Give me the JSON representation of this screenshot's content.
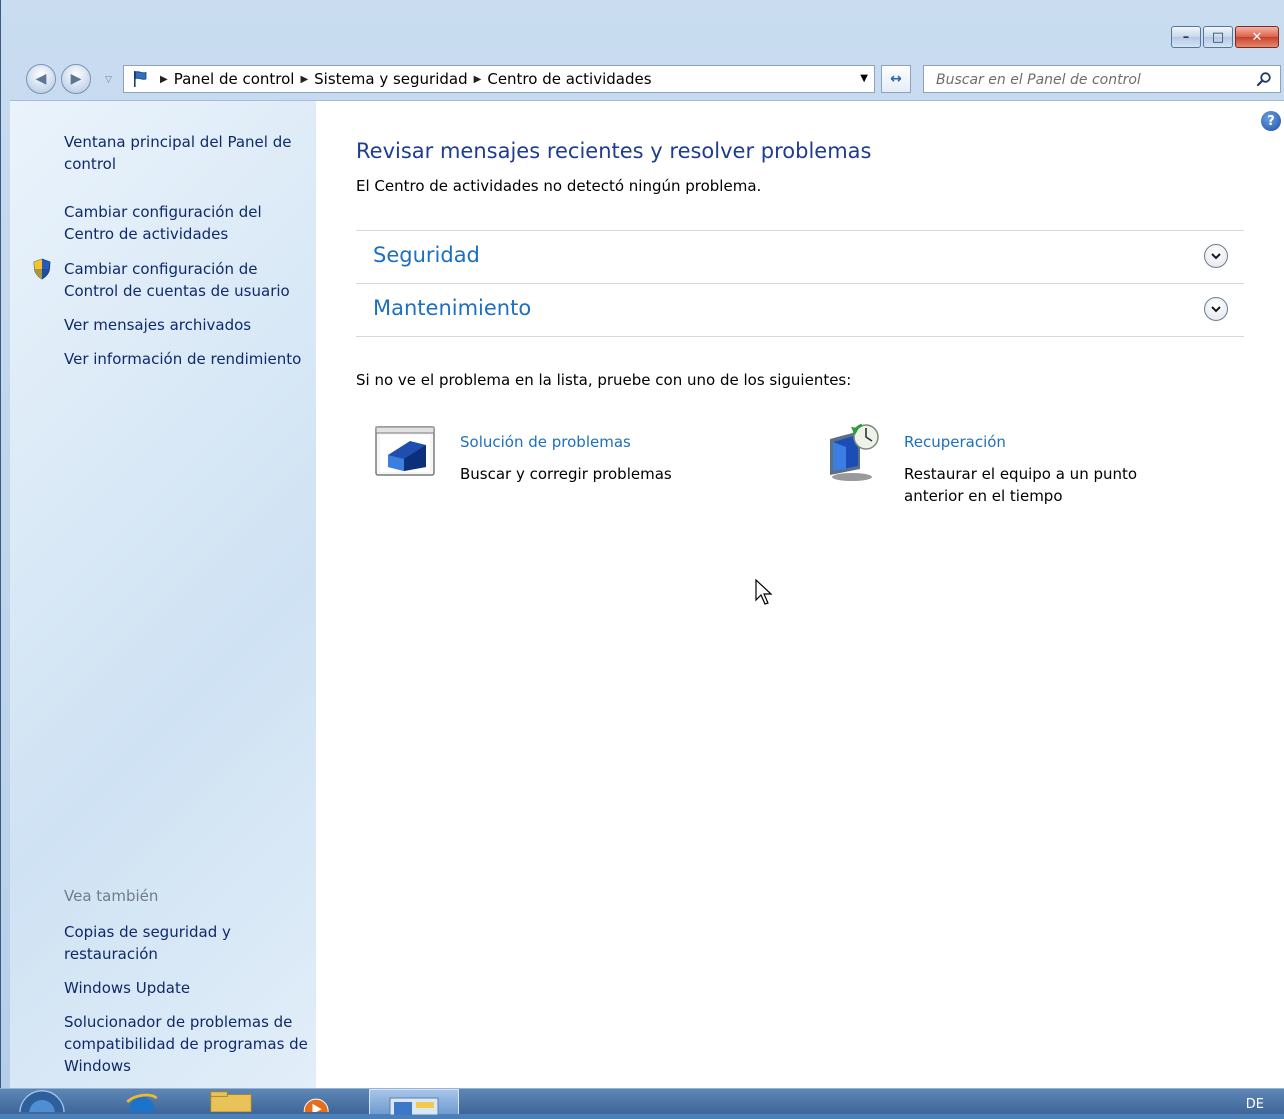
{
  "window": {
    "caption": {
      "minimize": "–",
      "maximize": "□",
      "close": "✕"
    }
  },
  "address_bar": {
    "crumbs": [
      "Panel de control",
      "Sistema y seguridad",
      "Centro de actividades"
    ]
  },
  "search": {
    "placeholder": "Buscar en el Panel de control"
  },
  "sidebar": {
    "links": [
      "Ventana principal del Panel de control",
      "Cambiar configuración del Centro de actividades",
      "Cambiar configuración de Control de cuentas de usuario",
      "Ver mensajes archivados",
      "Ver información de rendimiento"
    ],
    "see_also_label": "Vea también",
    "see_also": [
      "Copias de seguridad y restauración",
      "Windows Update",
      "Solucionador de problemas de compatibilidad de programas de Windows"
    ]
  },
  "main": {
    "title": "Revisar mensajes recientes y resolver problemas",
    "subtitle": "El Centro de actividades no detectó ningún problema.",
    "sections": [
      "Seguridad",
      "Mantenimiento"
    ],
    "hint": "Si no ve el problema en la lista, pruebe con uno de los siguientes:",
    "tools": [
      {
        "name": "Solución de problemas",
        "desc": "Buscar y corregir problemas",
        "icon": "troubleshooting-icon"
      },
      {
        "name": "Recuperación",
        "desc": "Restaurar el equipo a un punto anterior en el tiempo",
        "icon": "recovery-icon"
      }
    ]
  },
  "taskbar": {
    "language": "DE"
  },
  "colors": {
    "link": "#1d6fbf",
    "title": "#1e3d8f",
    "sidebar_link": "#0f2a6c"
  }
}
